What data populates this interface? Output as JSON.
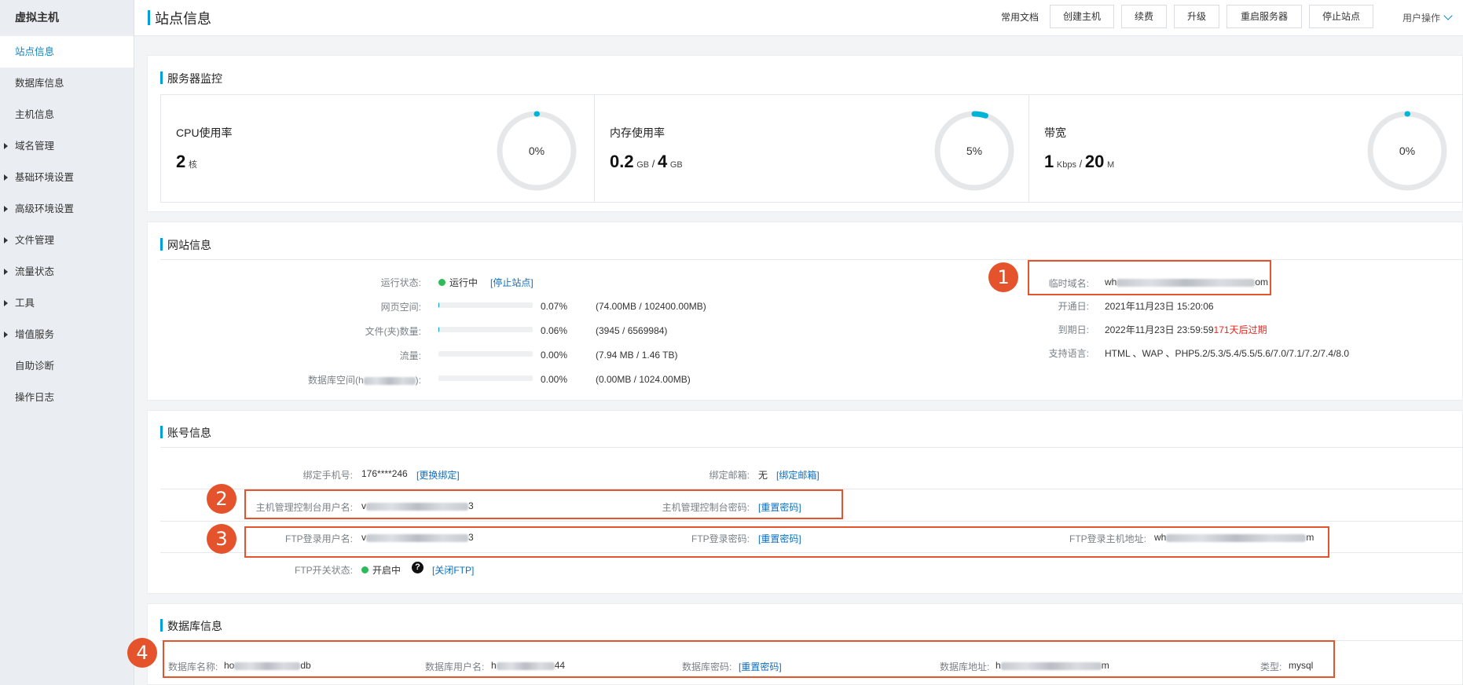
{
  "sidebar": {
    "brand": "虚拟主机",
    "items": [
      {
        "label": "站点信息"
      },
      {
        "label": "数据库信息"
      },
      {
        "label": "主机信息"
      },
      {
        "label": "域名管理"
      },
      {
        "label": "基础环境设置"
      },
      {
        "label": "高级环境设置"
      },
      {
        "label": "文件管理"
      },
      {
        "label": "流量状态"
      },
      {
        "label": "工具"
      },
      {
        "label": "增值服务"
      },
      {
        "label": "自助诊断"
      },
      {
        "label": "操作日志"
      }
    ]
  },
  "header": {
    "title": "站点信息",
    "docs": "常用文档",
    "buttons": [
      "创建主机",
      "续费",
      "升级",
      "重启服务器",
      "停止站点"
    ],
    "user_ops": "用户操作"
  },
  "monitor": {
    "title": "服务器监控",
    "cpu": {
      "label": "CPU使用率",
      "value": "2",
      "unit": "核",
      "percent_text": "0%",
      "percent": 0
    },
    "memory": {
      "label": "内存使用率",
      "used": "0.2",
      "used_unit": "GB",
      "sep": "/",
      "total": "4",
      "total_unit": "GB",
      "percent_text": "5%",
      "percent": 5
    },
    "bandwidth": {
      "label": "带宽",
      "used": "1",
      "used_unit": "Kbps",
      "sep": "/",
      "total": "20",
      "total_unit": "M",
      "percent_text": "0%",
      "percent": 0
    }
  },
  "website": {
    "title": "网站信息",
    "status_label": "运行状态:",
    "status_value": "运行中",
    "stop_link": "[停止站点]",
    "usage": [
      {
        "label": "网页空间:",
        "percent_text": "0.07%",
        "detail": "(74.00MB / 102400.00MB)",
        "fill": 0.0007
      },
      {
        "label": "文件(夹)数量:",
        "percent_text": "0.06%",
        "detail": "(3945 / 6569984)",
        "fill": 0.0006
      },
      {
        "label": "流量:",
        "percent_text": "0.00%",
        "detail": "(7.94 MB / 1.46 TB)",
        "fill": 0
      },
      {
        "label_prefix": "数据库空间(h",
        "label_suffix": "):",
        "percent_text": "0.00%",
        "detail": "(0.00MB / 1024.00MB)",
        "fill": 0
      }
    ],
    "temp_domain_label": "临时域名:",
    "temp_domain_prefix": "wh",
    "temp_domain_suffix": "om",
    "open_date_label": "开通日:",
    "open_date": "2021年11月23日 15:20:06",
    "expire_label": "到期日:",
    "expire_date": "2022年11月23日 23:59:59",
    "expire_remaining": "171天后过期",
    "langs_label": "支持语言:",
    "langs": "HTML 、WAP 、PHP5.2/5.3/5.4/5.5/5.6/7.0/7.1/7.2/7.4/8.0"
  },
  "account": {
    "title": "账号信息",
    "phone_label": "绑定手机号:",
    "phone": "176****246",
    "phone_link": "[更换绑定]",
    "email_label": "绑定邮箱:",
    "email": "无",
    "email_link": "[绑定邮箱]",
    "ctl_user_label": "主机管理控制台用户名:",
    "ctl_user_prefix": "v",
    "ctl_user_suffix": "3",
    "ctl_pwd_label": "主机管理控制台密码:",
    "ctl_pwd_link": "[重置密码]",
    "ftp_user_label": "FTP登录用户名:",
    "ftp_user_prefix": "v",
    "ftp_user_suffix": "3",
    "ftp_pwd_label": "FTP登录密码:",
    "ftp_pwd_link": "[重置密码]",
    "ftp_host_label": "FTP登录主机地址:",
    "ftp_host_prefix": "wh",
    "ftp_host_suffix": "m",
    "ftp_status_label": "FTP开关状态:",
    "ftp_status": "开启中",
    "ftp_help": "?",
    "ftp_close_link": "[关闭FTP]"
  },
  "database": {
    "title": "数据库信息",
    "name_label": "数据库名称:",
    "name_prefix": "ho",
    "name_suffix": "db",
    "user_label": "数据库用户名:",
    "user_prefix": "h",
    "user_suffix": "44",
    "pwd_label": "数据库密码:",
    "pwd_link": "[重置密码]",
    "addr_label": "数据库地址:",
    "addr_prefix": "h",
    "addr_suffix": "m",
    "type_label": "类型:",
    "type": "mysql"
  },
  "annotations": [
    "1",
    "2",
    "3",
    "4"
  ],
  "colors": {
    "accent": "#00a0e0",
    "link": "#0a6fc2",
    "annotation": "#e5532c",
    "running": "#2dbb5a",
    "warning": "#e8261c"
  }
}
